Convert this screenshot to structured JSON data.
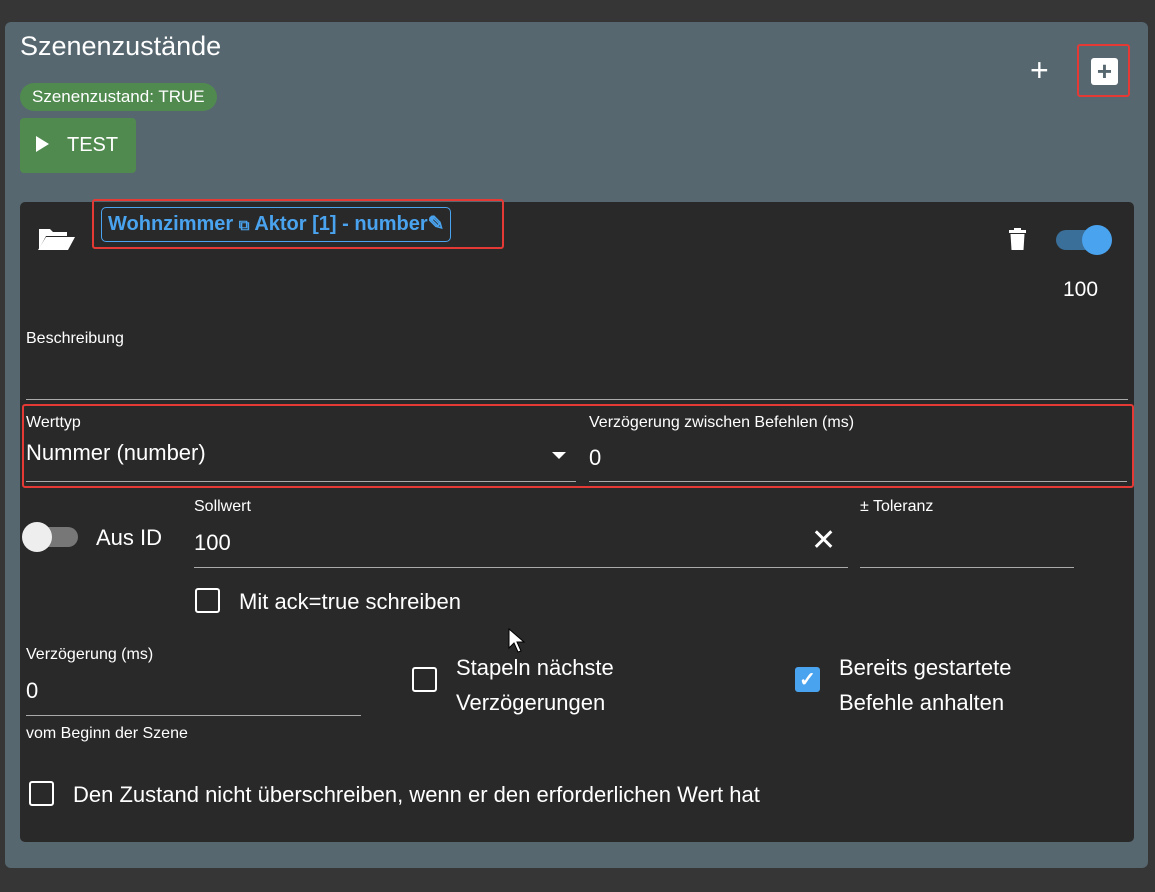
{
  "header": {
    "title": "Szenenzustände",
    "state_chip": "Szenenzustand: TRUE",
    "test_label": "TEST",
    "add_icon": "plus-icon",
    "add_box_icon": "plus-box-icon"
  },
  "colors": {
    "panel": "#566770",
    "card": "#292929",
    "accent": "#4aa3ee",
    "success": "#508a4f",
    "highlight": "#e53935"
  },
  "member": {
    "id_parts": {
      "room": "Wohnzimmer",
      "icon": "window-restore-icon",
      "name": "Aktor [1] - number"
    },
    "enabled": true,
    "value_label": "100",
    "description_label": "Beschreibung",
    "description_value": "",
    "value_type_label": "Werttyp",
    "value_type_value": "Nummer (number)",
    "delay_between_label": "Verzögerung zwischen Befehlen (ms)",
    "delay_between_value": "0",
    "from_id_label": "Aus ID",
    "from_id_enabled": false,
    "setpoint_label": "Sollwert",
    "setpoint_value": "100",
    "tolerance_label": "± Toleranz",
    "tolerance_value": "",
    "ack_label": "Mit ack=true schreiben",
    "ack_checked": false,
    "delay_label": "Verzögerung (ms)",
    "delay_value": "0",
    "delay_helper": "vom Beginn der Szene",
    "stack_label_1": "Stapeln nächste",
    "stack_label_2": "Verzögerungen",
    "stack_checked": false,
    "stop_label_1": "Bereits gestartete",
    "stop_label_2": "Befehle anhalten",
    "stop_checked": true,
    "no_overwrite_label": "Den Zustand nicht überschreiben, wenn er den erforderlichen Wert hat",
    "no_overwrite_checked": false
  }
}
